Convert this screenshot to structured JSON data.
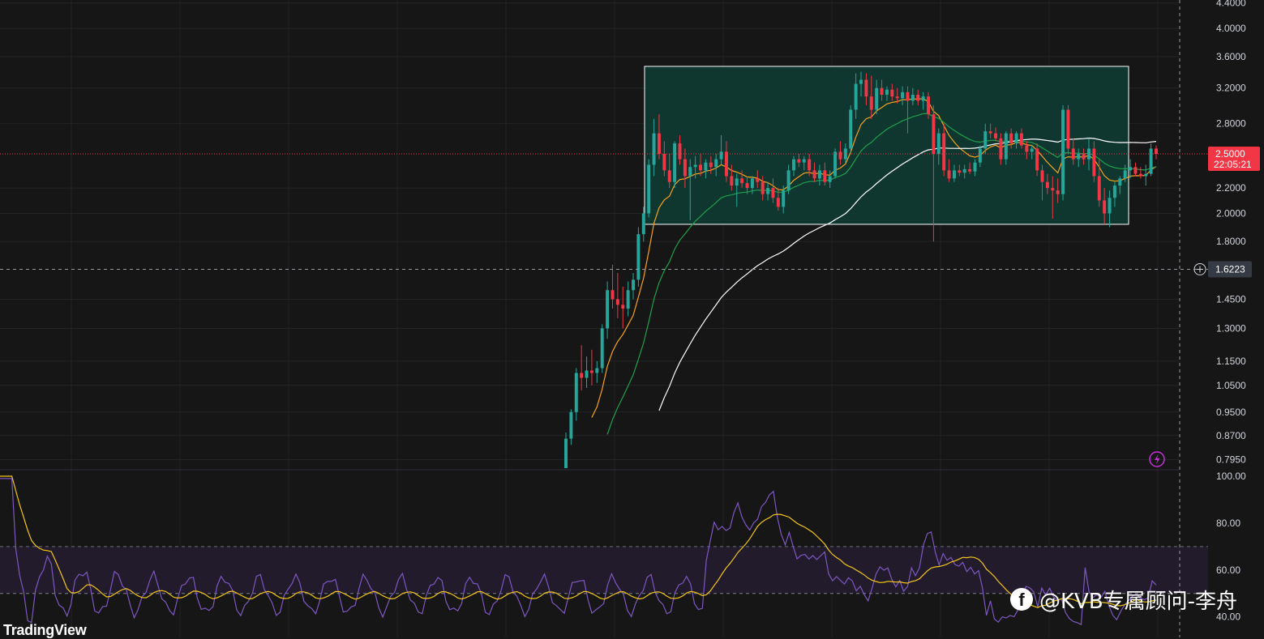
{
  "brand": "TradingView",
  "watermark": {
    "icon": "facebook-icon",
    "text": "@KVB专属顾问-李舟"
  },
  "colors": {
    "background": "#161616",
    "up": "#26a69a",
    "down": "#f23645",
    "ma_fast": "#f7a21b",
    "ma_mid": "#1fa04b",
    "ma_slow": "#ffffff",
    "rsi": "#7e57c2",
    "rsi_ma": "#f5c518",
    "range_box_fill": "#0f3a33",
    "range_box_stroke": "#ffffff",
    "price_line": "#f23645"
  },
  "chart_data": [
    {
      "type": "candlestick",
      "price_axis_ticks": [
        "4.4000",
        "4.0000",
        "3.6000",
        "3.2000",
        "2.8000",
        "2.2000",
        "2.0000",
        "1.8000",
        "1.4500",
        "1.3000",
        "1.1500",
        "1.0500",
        "0.9500",
        "0.8700",
        "0.7950"
      ],
      "price_axis_range": [
        0.77,
        4.45
      ],
      "scale": "log",
      "current_price": {
        "value": 2.5,
        "label": "2.5000",
        "countdown": "22:05:21"
      },
      "crosshair_price": {
        "value": 1.6223,
        "label": "1.6223"
      },
      "range_box": {
        "top": 3.47,
        "bottom": 1.92
      },
      "candles": [
        [
          0.75,
          0.88,
          0.74,
          0.86
        ],
        [
          0.86,
          0.96,
          0.84,
          0.95
        ],
        [
          0.95,
          1.12,
          0.92,
          1.1
        ],
        [
          1.1,
          1.22,
          1.03,
          1.08
        ],
        [
          1.08,
          1.17,
          1.04,
          1.11
        ],
        [
          1.11,
          1.2,
          1.05,
          1.1
        ],
        [
          1.1,
          1.15,
          1.06,
          1.12
        ],
        [
          1.12,
          1.32,
          1.1,
          1.3
        ],
        [
          1.3,
          1.55,
          1.25,
          1.5
        ],
        [
          1.5,
          1.65,
          1.4,
          1.45
        ],
        [
          1.45,
          1.6,
          1.35,
          1.42
        ],
        [
          1.42,
          1.52,
          1.3,
          1.4
        ],
        [
          1.4,
          1.55,
          1.36,
          1.5
        ],
        [
          1.5,
          1.6,
          1.45,
          1.56
        ],
        [
          1.56,
          1.9,
          1.52,
          1.85
        ],
        [
          1.85,
          2.05,
          1.8,
          2.0
        ],
        [
          2.0,
          2.45,
          1.97,
          2.4
        ],
        [
          2.4,
          2.85,
          2.3,
          2.7
        ],
        [
          2.7,
          2.9,
          2.45,
          2.5
        ],
        [
          2.5,
          2.62,
          2.3,
          2.35
        ],
        [
          2.35,
          2.5,
          2.2,
          2.25
        ],
        [
          2.25,
          2.62,
          2.2,
          2.6
        ],
        [
          2.6,
          2.68,
          2.4,
          2.45
        ],
        [
          2.45,
          2.55,
          2.2,
          2.3
        ],
        [
          2.3,
          2.45,
          1.95,
          2.38
        ],
        [
          2.38,
          2.48,
          2.28,
          2.4
        ],
        [
          2.4,
          2.5,
          2.3,
          2.35
        ],
        [
          2.35,
          2.45,
          2.28,
          2.42
        ],
        [
          2.42,
          2.48,
          2.32,
          2.38
        ],
        [
          2.38,
          2.5,
          2.3,
          2.45
        ],
        [
          2.45,
          2.68,
          2.4,
          2.52
        ],
        [
          2.52,
          2.62,
          2.25,
          2.3
        ],
        [
          2.3,
          2.4,
          2.18,
          2.22
        ],
        [
          2.22,
          2.32,
          2.05,
          2.28
        ],
        [
          2.28,
          2.35,
          2.2,
          2.24
        ],
        [
          2.24,
          2.3,
          2.15,
          2.2
        ],
        [
          2.2,
          2.3,
          2.15,
          2.28
        ],
        [
          2.28,
          2.35,
          2.2,
          2.25
        ],
        [
          2.25,
          2.3,
          2.1,
          2.15
        ],
        [
          2.15,
          2.25,
          2.1,
          2.2
        ],
        [
          2.2,
          2.28,
          2.08,
          2.12
        ],
        [
          2.12,
          2.2,
          2.02,
          2.05
        ],
        [
          2.05,
          2.22,
          2.0,
          2.18
        ],
        [
          2.18,
          2.4,
          2.15,
          2.35
        ],
        [
          2.35,
          2.48,
          2.3,
          2.45
        ],
        [
          2.45,
          2.5,
          2.38,
          2.42
        ],
        [
          2.42,
          2.48,
          2.35,
          2.45
        ],
        [
          2.45,
          2.5,
          2.3,
          2.35
        ],
        [
          2.35,
          2.42,
          2.25,
          2.28
        ],
        [
          2.28,
          2.4,
          2.22,
          2.35
        ],
        [
          2.35,
          2.42,
          2.22,
          2.25
        ],
        [
          2.25,
          2.35,
          2.2,
          2.3
        ],
        [
          2.3,
          2.55,
          2.28,
          2.52
        ],
        [
          2.52,
          2.62,
          2.4,
          2.45
        ],
        [
          2.45,
          2.6,
          2.42,
          2.55
        ],
        [
          2.55,
          3.0,
          2.5,
          2.95
        ],
        [
          2.95,
          3.38,
          2.85,
          3.25
        ],
        [
          3.25,
          3.4,
          3.1,
          3.3
        ],
        [
          3.3,
          3.38,
          3.0,
          3.1
        ],
        [
          3.1,
          3.35,
          2.85,
          2.95
        ],
        [
          2.95,
          3.3,
          2.9,
          3.2
        ],
        [
          3.2,
          3.3,
          3.05,
          3.12
        ],
        [
          3.12,
          3.22,
          3.05,
          3.18
        ],
        [
          3.18,
          3.25,
          3.05,
          3.1
        ],
        [
          3.1,
          3.2,
          3.02,
          3.08
        ],
        [
          3.08,
          3.22,
          3.0,
          3.15
        ],
        [
          3.15,
          3.22,
          2.7,
          3.05
        ],
        [
          3.05,
          3.2,
          3.0,
          3.12
        ],
        [
          3.12,
          3.18,
          3.0,
          3.05
        ],
        [
          3.05,
          3.15,
          2.95,
          3.1
        ],
        [
          3.1,
          3.15,
          2.85,
          2.9
        ],
        [
          2.9,
          3.0,
          1.8,
          2.5
        ],
        [
          2.5,
          2.75,
          2.4,
          2.7
        ],
        [
          2.7,
          2.8,
          2.3,
          2.35
        ],
        [
          2.35,
          2.45,
          2.25,
          2.28
        ],
        [
          2.28,
          2.4,
          2.25,
          2.35
        ],
        [
          2.35,
          2.4,
          2.3,
          2.33
        ],
        [
          2.33,
          2.4,
          2.28,
          2.36
        ],
        [
          2.36,
          2.42,
          2.32,
          2.34
        ],
        [
          2.34,
          2.45,
          2.3,
          2.42
        ],
        [
          2.42,
          2.58,
          2.38,
          2.55
        ],
        [
          2.55,
          2.8,
          2.5,
          2.72
        ],
        [
          2.72,
          2.8,
          2.65,
          2.7
        ],
        [
          2.7,
          2.76,
          2.62,
          2.65
        ],
        [
          2.65,
          2.7,
          2.4,
          2.45
        ],
        [
          2.45,
          2.72,
          2.4,
          2.7
        ],
        [
          2.7,
          2.75,
          2.55,
          2.6
        ],
        [
          2.6,
          2.72,
          2.55,
          2.7
        ],
        [
          2.7,
          2.75,
          2.55,
          2.58
        ],
        [
          2.58,
          2.62,
          2.45,
          2.52
        ],
        [
          2.52,
          2.58,
          2.45,
          2.55
        ],
        [
          2.55,
          2.6,
          2.3,
          2.35
        ],
        [
          2.35,
          2.4,
          2.1,
          2.25
        ],
        [
          2.25,
          2.32,
          2.15,
          2.2
        ],
        [
          2.2,
          2.3,
          1.96,
          2.18
        ],
        [
          2.18,
          2.28,
          2.08,
          2.15
        ],
        [
          2.15,
          3.0,
          2.1,
          2.95
        ],
        [
          2.95,
          3.0,
          2.5,
          2.55
        ],
        [
          2.55,
          2.65,
          2.4,
          2.45
        ],
        [
          2.45,
          2.55,
          2.38,
          2.5
        ],
        [
          2.5,
          2.55,
          2.4,
          2.45
        ],
        [
          2.45,
          2.65,
          2.35,
          2.55
        ],
        [
          2.55,
          2.62,
          2.25,
          2.3
        ],
        [
          2.3,
          2.45,
          2.05,
          2.1
        ],
        [
          2.1,
          2.2,
          1.92,
          2.0
        ],
        [
          2.0,
          2.18,
          1.9,
          2.12
        ],
        [
          2.12,
          2.25,
          2.05,
          2.22
        ],
        [
          2.22,
          2.3,
          2.15,
          2.28
        ],
        [
          2.28,
          2.4,
          2.25,
          2.35
        ],
        [
          2.35,
          2.45,
          2.28,
          2.38
        ],
        [
          2.38,
          2.42,
          2.3,
          2.32
        ],
        [
          2.32,
          2.38,
          2.28,
          2.3
        ],
        [
          2.3,
          2.4,
          2.22,
          2.32
        ],
        [
          2.32,
          2.6,
          2.3,
          2.55
        ],
        [
          2.55,
          2.58,
          2.45,
          2.5
        ]
      ]
    },
    {
      "type": "line",
      "name": "RSI",
      "y_axis_ticks": [
        "100.00",
        "80.00",
        "60.00",
        "40.00"
      ],
      "ylim": [
        33,
        100
      ],
      "band": [
        50,
        70
      ],
      "midline": 50
    }
  ]
}
